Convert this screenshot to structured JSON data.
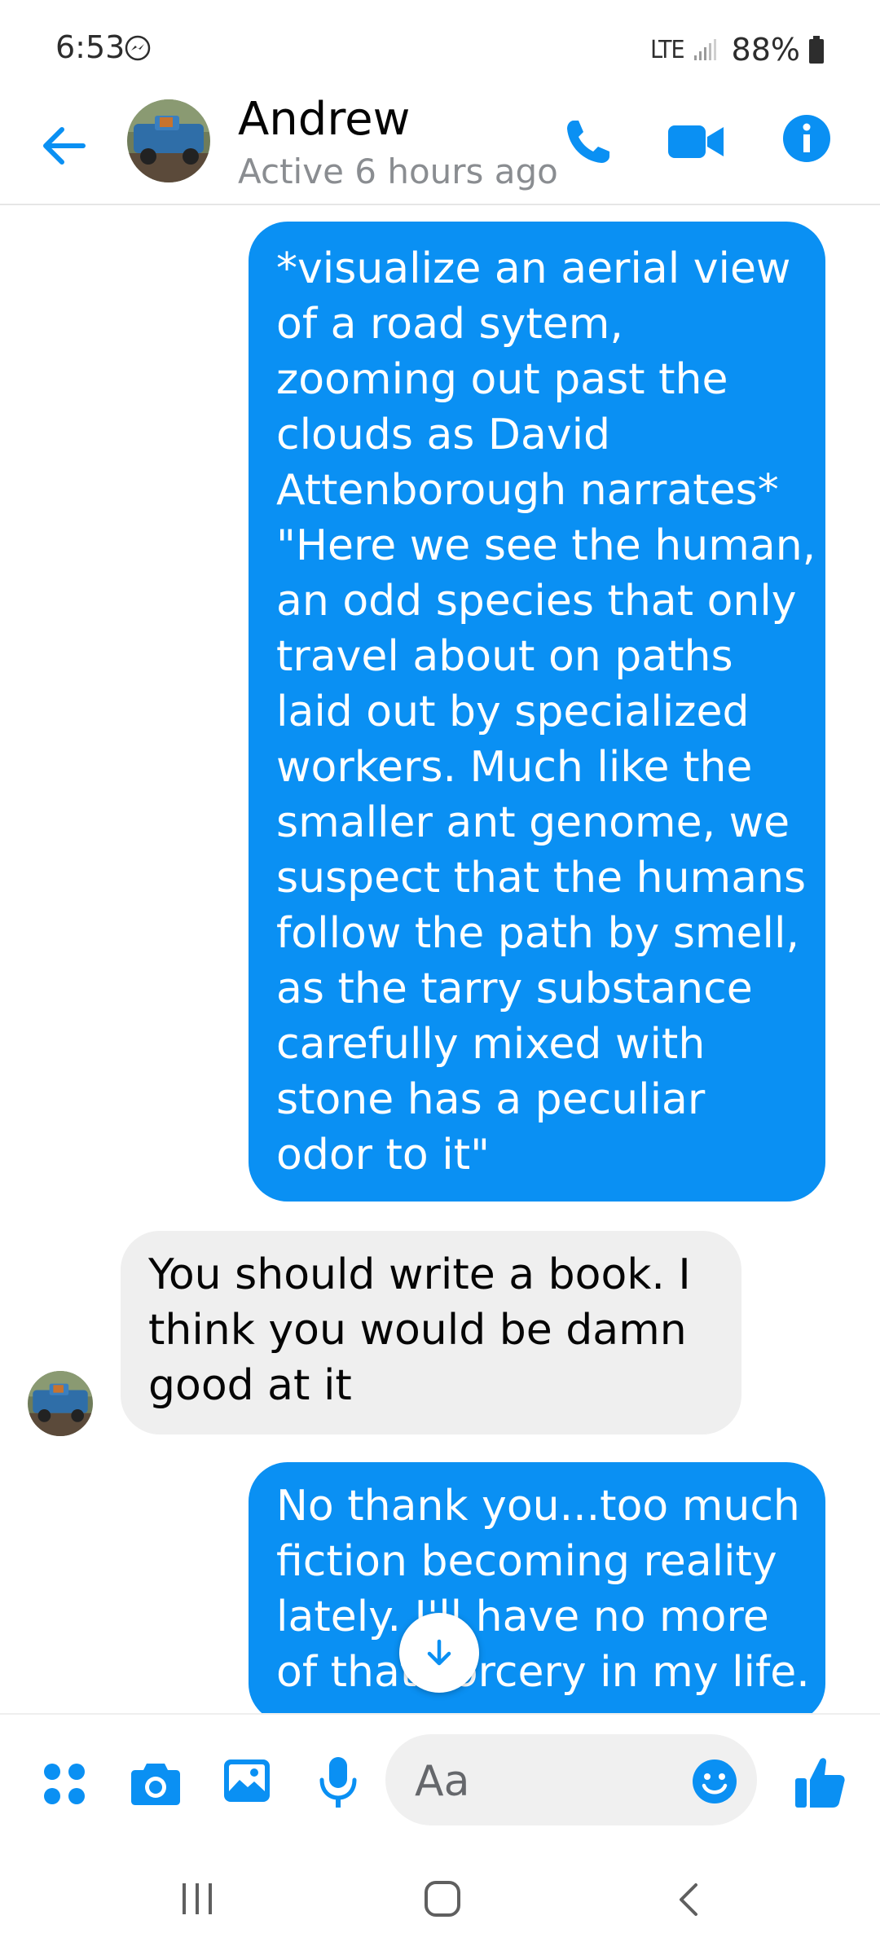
{
  "status_bar": {
    "time": "6:53",
    "network": "LTE",
    "battery": "88%"
  },
  "header": {
    "contact_name": "Andrew",
    "active_status": "Active 6 hours ago"
  },
  "messages": [
    {
      "direction": "outgoing",
      "lines": [
        "*visualize an aerial view",
        "of a road sytem,",
        "zooming out past the",
        "clouds as David",
        "Attenborough narrates*",
        "\"Here we see the human,",
        "an odd species that only",
        "travel about on paths",
        "laid out by specialized",
        "workers. Much like the",
        "smaller ant genome, we",
        "suspect that the humans",
        "follow the path by smell,",
        "as the tarry substance",
        "carefully mixed with",
        "stone has a peculiar",
        "odor to it\""
      ]
    },
    {
      "direction": "incoming",
      "lines": [
        "You should write a book. I",
        "think you would be damn",
        "good at it"
      ]
    },
    {
      "direction": "outgoing",
      "lines": [
        "No thank you...too much",
        "fiction becoming reality",
        "lately. I'll have no more",
        "of that sorcery in my life."
      ]
    }
  ],
  "composer": {
    "placeholder": "Aa"
  },
  "colors": {
    "accent": "#0a90f3",
    "incoming_bubble": "#efefef"
  }
}
